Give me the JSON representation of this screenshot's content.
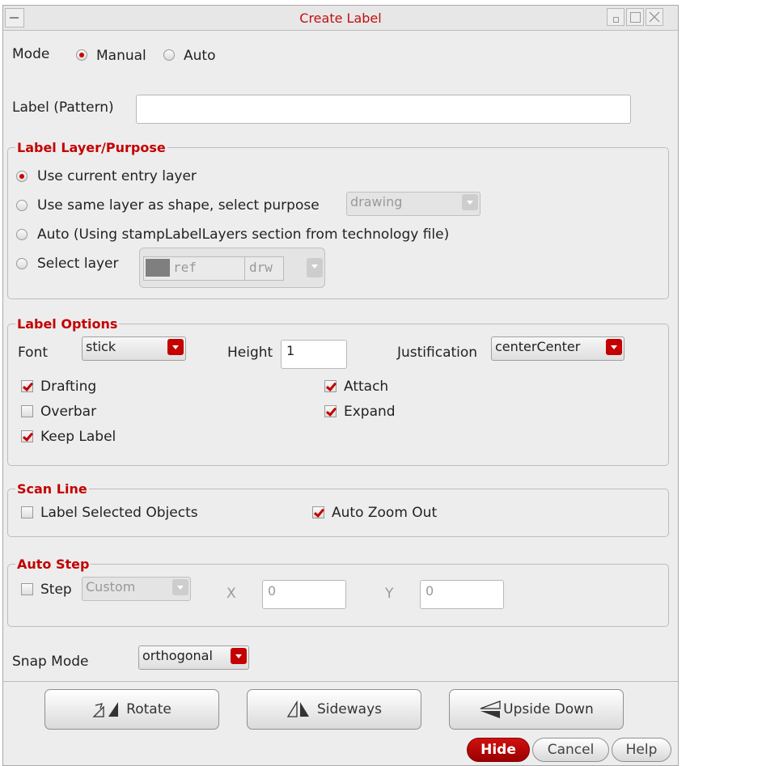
{
  "window": {
    "title": "Create Label"
  },
  "mode": {
    "label": "Mode",
    "options": [
      "Manual",
      "Auto"
    ],
    "selected": "Manual"
  },
  "pattern": {
    "label": "Label (Pattern)",
    "value": ""
  },
  "layer_purpose": {
    "title": "Label Layer/Purpose",
    "options": [
      "Use current entry layer",
      "Use same layer as shape, select purpose",
      "Auto (Using stampLabelLayers section from technology file)",
      "Select layer"
    ],
    "selected": "Use current entry layer",
    "purpose_value": "drawing",
    "layer_name": "ref",
    "layer_purpose": "drw"
  },
  "label_options": {
    "title": "Label Options",
    "font_label": "Font",
    "font_value": "stick",
    "height_label": "Height",
    "height_value": "1",
    "justification_label": "Justification",
    "justification_value": "centerCenter",
    "drafting": "Drafting",
    "overbar": "Overbar",
    "keep_label": "Keep Label",
    "attach": "Attach",
    "expand": "Expand",
    "checked": {
      "drafting": true,
      "overbar": false,
      "keep_label": true,
      "attach": true,
      "expand": true
    }
  },
  "scan_line": {
    "title": "Scan Line",
    "label_selected": "Label Selected Objects",
    "auto_zoom": "Auto Zoom Out",
    "checked": {
      "label_selected": false,
      "auto_zoom": true
    }
  },
  "auto_step": {
    "title": "Auto Step",
    "step_label": "Step",
    "step_checked": false,
    "step_value": "Custom",
    "x_label": "X",
    "x_value": "0",
    "y_label": "Y",
    "y_value": "0"
  },
  "snap": {
    "label": "Snap Mode",
    "value": "orthogonal"
  },
  "buttons": {
    "rotate": "Rotate",
    "sideways": "Sideways",
    "upside_down": "Upside Down",
    "hide": "Hide",
    "cancel": "Cancel",
    "help": "Help"
  },
  "colors": {
    "accent": "#c40000",
    "panel": "#ededed"
  }
}
